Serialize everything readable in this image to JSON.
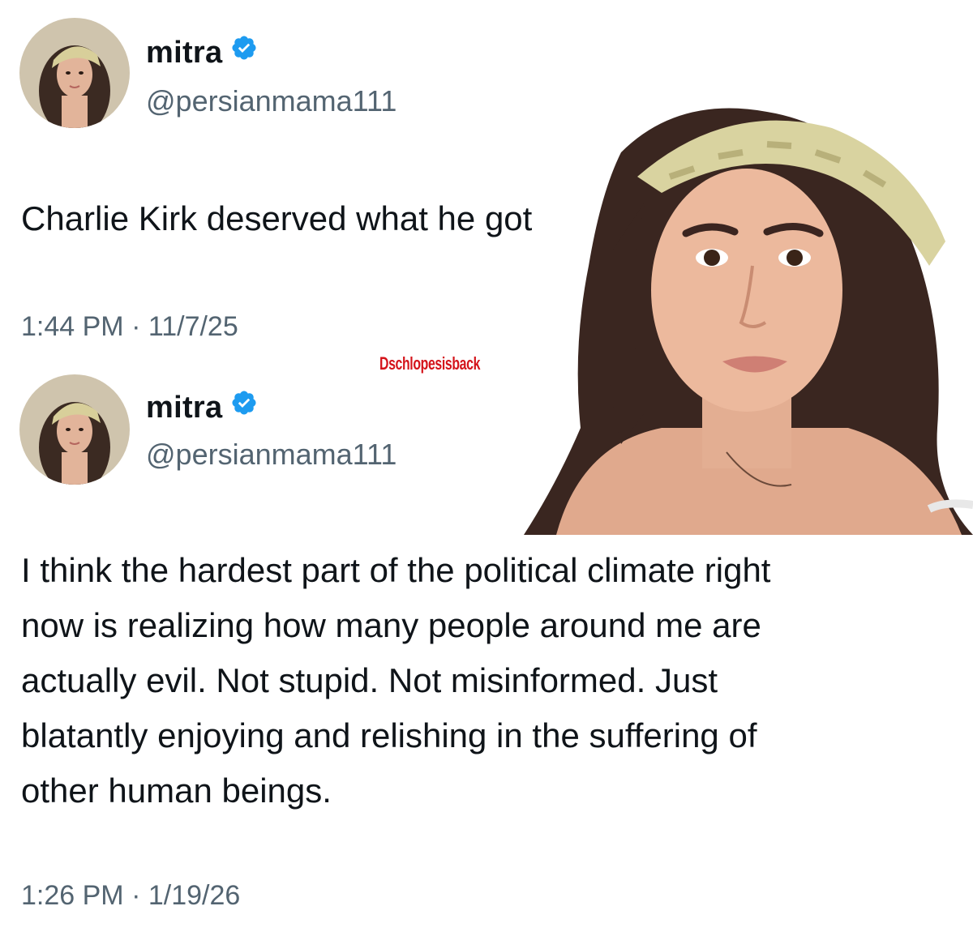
{
  "tweets": [
    {
      "display_name": "mitra",
      "handle": "@persianmama111",
      "text": "Charlie Kirk deserved what he got",
      "timestamp": "1:44 PM · 11/7/25"
    },
    {
      "display_name": "mitra",
      "handle": "@persianmama111",
      "text_lines": [
        "I think the hardest part of the political climate right",
        "now is realizing how many people around me are",
        "actually evil. Not stupid. Not misinformed. Just",
        "blatantly enjoying and relishing in the suffering of",
        "other human beings."
      ],
      "timestamp": "1:26 PM · 1/19/26"
    }
  ],
  "watermark": "Dschlopesisback",
  "colors": {
    "verified_blue": "#1d9bf0",
    "text": "#0f1419",
    "secondary": "#536471",
    "watermark": "#d4141b"
  },
  "icons": {
    "verified": "verified-badge-icon"
  }
}
